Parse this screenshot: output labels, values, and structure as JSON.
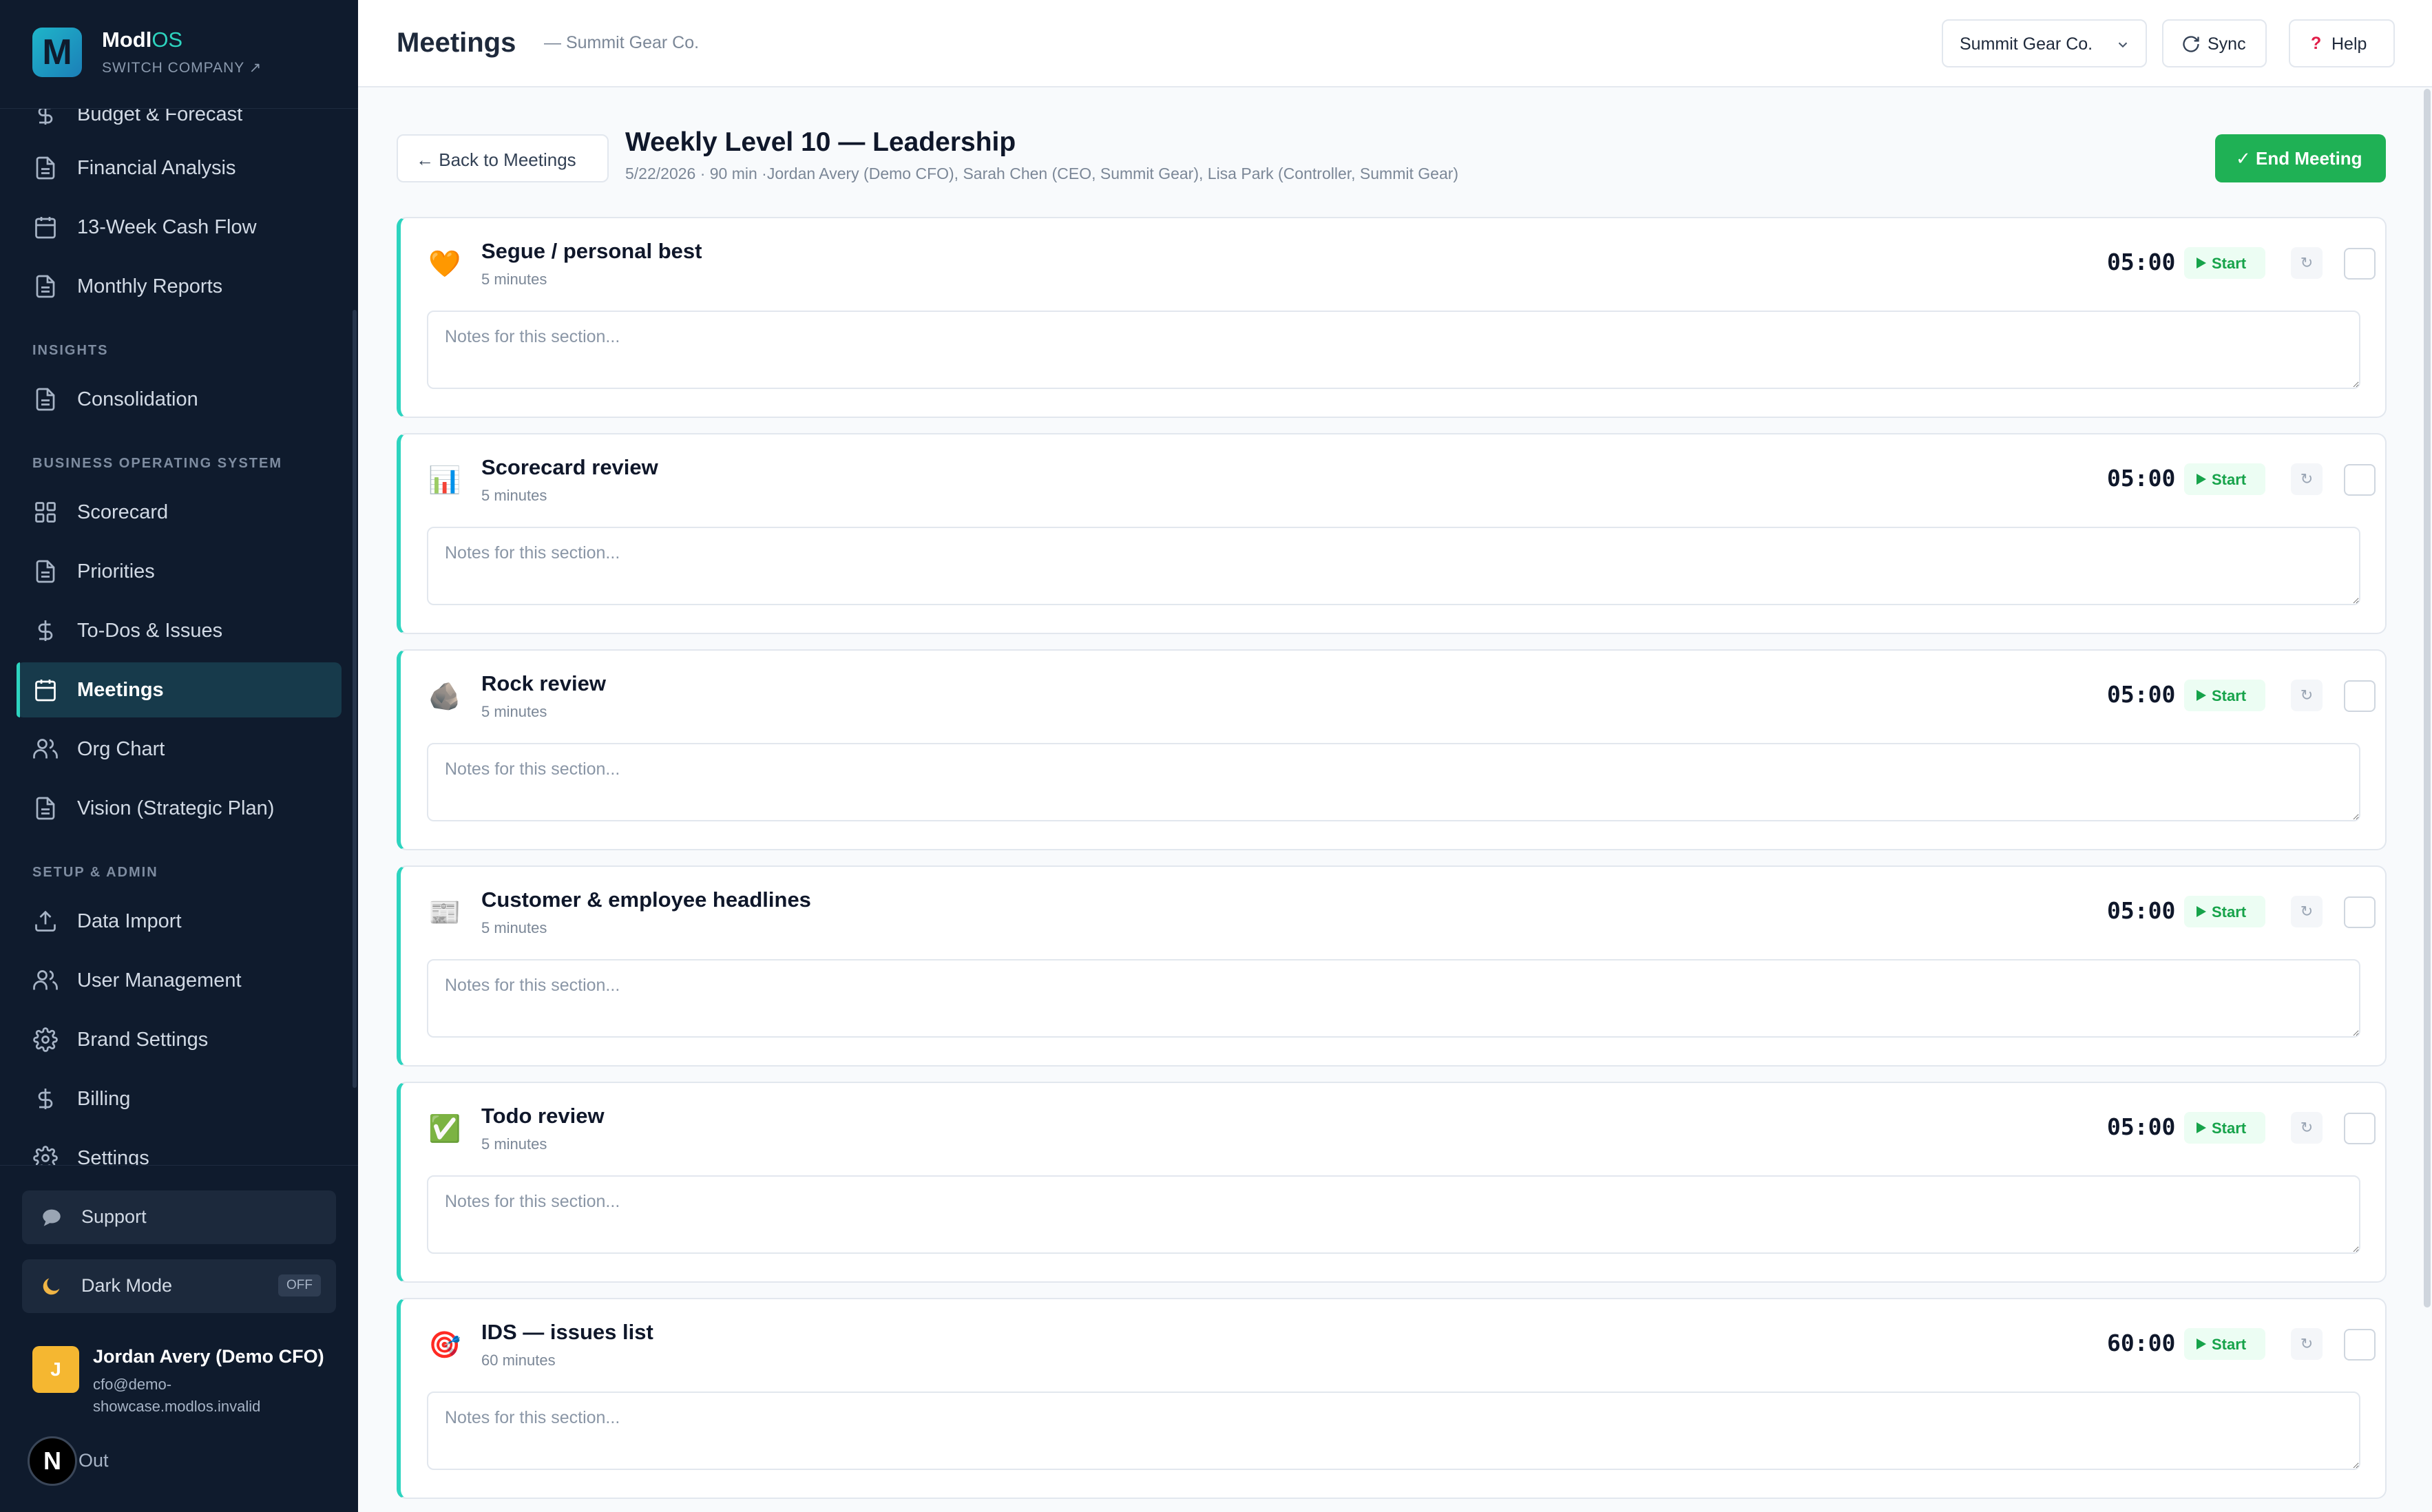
{
  "brand": {
    "logo_letter": "M",
    "name_main": "Modl",
    "name_accent": "OS",
    "switch_label": "SWITCH COMPANY ↗"
  },
  "sidebar": {
    "items_top": [
      {
        "label": "Budget & Forecast",
        "icon": "dollar-icon"
      },
      {
        "label": "Financial Analysis",
        "icon": "document-icon"
      },
      {
        "label": "13-Week Cash Flow",
        "icon": "calendar-icon"
      },
      {
        "label": "Monthly Reports",
        "icon": "document-icon"
      }
    ],
    "sections": {
      "insights": "INSIGHTS",
      "bos": "BUSINESS OPERATING SYSTEM",
      "setup": "SETUP & ADMIN"
    },
    "insights_items": [
      {
        "label": "Consolidation",
        "icon": "document-icon"
      }
    ],
    "bos_items": [
      {
        "label": "Scorecard",
        "icon": "grid-icon"
      },
      {
        "label": "Priorities",
        "icon": "document-icon"
      },
      {
        "label": "To-Dos & Issues",
        "icon": "dollar-icon"
      },
      {
        "label": "Meetings",
        "icon": "calendar-icon",
        "active": true
      },
      {
        "label": "Org Chart",
        "icon": "users-icon"
      },
      {
        "label": "Vision (Strategic Plan)",
        "icon": "document-icon"
      }
    ],
    "setup_items": [
      {
        "label": "Data Import",
        "icon": "upload-icon"
      },
      {
        "label": "User Management",
        "icon": "users-icon"
      },
      {
        "label": "Brand Settings",
        "icon": "gear-icon"
      },
      {
        "label": "Billing",
        "icon": "dollar-icon"
      },
      {
        "label": "Settings",
        "icon": "gear-icon"
      }
    ],
    "support_label": "Support",
    "dark_mode_label": "Dark Mode",
    "dark_mode_state": "OFF",
    "user": {
      "initial": "J",
      "name": "Jordan Avery (Demo CFO)",
      "email": "cfo@demo-showcase.modlos.invalid"
    },
    "nx_badge": "N",
    "sign_out_label": "Out"
  },
  "topbar": {
    "title": "Meetings",
    "subtitle": "— Summit Gear Co.",
    "company_select": "Summit Gear Co.",
    "sync_label": "Sync",
    "help_label": "Help"
  },
  "meeting": {
    "back_label": "← Back to Meetings",
    "title": "Weekly Level 10 — Leadership",
    "meta": "5/22/2026 · 90 min ·Jordan Avery (Demo CFO), Sarah Chen (CEO, Summit Gear), Lisa Park (Controller, Summit Gear)",
    "end_label": "✓ End Meeting",
    "start_label": "Start",
    "reset_glyph": "↻",
    "notes_placeholder": "Notes for this section...",
    "accent_color": "#2dd4bf",
    "sections": [
      {
        "title": "Segue / personal best",
        "duration": "5 minutes",
        "timer": "05:00",
        "icon": "heart-icon",
        "glyph": "🧡"
      },
      {
        "title": "Scorecard review",
        "duration": "5 minutes",
        "timer": "05:00",
        "icon": "bar-chart-icon",
        "glyph": "📊"
      },
      {
        "title": "Rock review",
        "duration": "5 minutes",
        "timer": "05:00",
        "icon": "rock-icon",
        "glyph": "🪨"
      },
      {
        "title": "Customer & employee headlines",
        "duration": "5 minutes",
        "timer": "05:00",
        "icon": "newspaper-icon",
        "glyph": "📰"
      },
      {
        "title": "Todo review",
        "duration": "5 minutes",
        "timer": "05:00",
        "icon": "checkbox-icon",
        "glyph": "✅"
      },
      {
        "title": "IDS — issues list",
        "duration": "60 minutes",
        "timer": "60:00",
        "icon": "target-icon",
        "glyph": "🎯"
      }
    ]
  }
}
